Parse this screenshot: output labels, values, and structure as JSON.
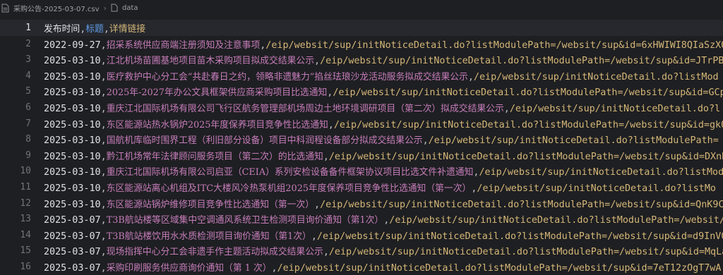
{
  "breadcrumb": {
    "file": "采购公告-2025-03-07.csv",
    "folder": "data",
    "file_icon": "csv-file-icon",
    "folder_icon": "document-icon"
  },
  "editor": {
    "current_line": 1,
    "header": {
      "number": "1",
      "col1": "发布时间",
      "col2": "标题",
      "col3": "详情链接"
    },
    "rows": [
      {
        "number": "2",
        "date": "2022-09-27",
        "title": "招采系统供应商端注册须知及注意事项",
        "url": "/eip/websit/sup/initNoticeDetail.do?listModulePath=/websit/sup&id=6xHWIWI8QIaSzXQ"
      },
      {
        "number": "3",
        "date": "2025-03-10",
        "title": "江北机场苗圃基地项目苗木采购项目拟成交结果公示",
        "url": "/eip/websit/sup/initNoticeDetail.do?listModulePath=/websit/sup&id=JTrPBN"
      },
      {
        "number": "4",
        "date": "2025-03-10",
        "title": "医疗救护中心分工会“共赴春日之约，领略非遗魅力”掐丝珐琅沙龙活动服务拟成交结果公示",
        "url": "/eip/websit/sup/initNoticeDetail.do?listMod"
      },
      {
        "number": "5",
        "date": "2025-03-10",
        "title": "2025年-2027年办公文具框架供应商采购项目比选通知",
        "url": "/eip/websit/sup/initNoticeDetail.do?listModulePath=/websit/sup&id=GCp"
      },
      {
        "number": "6",
        "date": "2025-03-10",
        "title": "重庆江北国际机场有限公司飞行区航务管理部机场周边土地环境调研项目（第二次）拟成交结果公示",
        "url": "/eip/websit/sup/initNoticeDetail.do?l"
      },
      {
        "number": "7",
        "date": "2025-03-10",
        "title": "东区能源站热水锅炉2025年度保养项目竞争性比选通知",
        "url": "/eip/websit/sup/initNoticeDetail.do?listModulePath=/websit/sup&id=gkQ"
      },
      {
        "number": "8",
        "date": "2025-03-10",
        "title": "国航机库临时围界工程（利旧部分设备）项目中科润程设备部分拟成交结果公示",
        "url": "/eip/websit/sup/initNoticeDetail.do?listModulePath="
      },
      {
        "number": "9",
        "date": "2025-03-10",
        "title": "黔江机场常年法律顾问服务项目（第二次）的比选通知",
        "url": "/eip/websit/sup/initNoticeDetail.do?listModulePath=/websit/sup&id=DXnB"
      },
      {
        "number": "10",
        "date": "2025-03-10",
        "title": "重庆江北国际机场有限公司启亚（CEIA）系列安检设备备件框架协议项目比选文件补遗通知",
        "url": "/eip/websit/sup/initNoticeDetail.do?listModu"
      },
      {
        "number": "11",
        "date": "2025-03-10",
        "title": "东区能源站离心机组及ITC大楼风冷热泵机组2025年度保养项目竞争性比选通知（第一次）",
        "url": "/eip/websit/sup/initNoticeDetail.do?listMo"
      },
      {
        "number": "12",
        "date": "2025-03-10",
        "title": "东区能源站锅炉维修项目竞争性比选通知（第一次）",
        "url": "/eip/websit/sup/initNoticeDetail.do?listModulePath=/websit/sup&id=QnK9Cv"
      },
      {
        "number": "13",
        "date": "2025-03-07",
        "title": "T3B航站楼等区域集中空调通风系统卫生检测项目询价通知（第1次）",
        "url": "/eip/websit/sup/initNoticeDetail.do?listModulePath=/websit/"
      },
      {
        "number": "14",
        "date": "2025-03-07",
        "title": "T3B航站楼饮用水水质检测项目询价通知（第1次）",
        "url": "/eip/websit/sup/initNoticeDetail.do?listModulePath=/websit/sup&id=d9InV0d"
      },
      {
        "number": "15",
        "date": "2025-03-07",
        "title": "现场指挥中心分工会非遗手作主题活动拟成交结果公示",
        "url": "/eip/websit/sup/initNoticeDetail.do?listModulePath=/websit/sup&id=MqLa"
      },
      {
        "number": "16",
        "date": "2025-03-07",
        "title": "采购印刷服务供应商询价通知（第 1 次）",
        "url": "/eip/websit/sup/initNoticeDetail.do?listModulePath=/websit/sup&id=7eT12zOgT7wA"
      }
    ]
  }
}
